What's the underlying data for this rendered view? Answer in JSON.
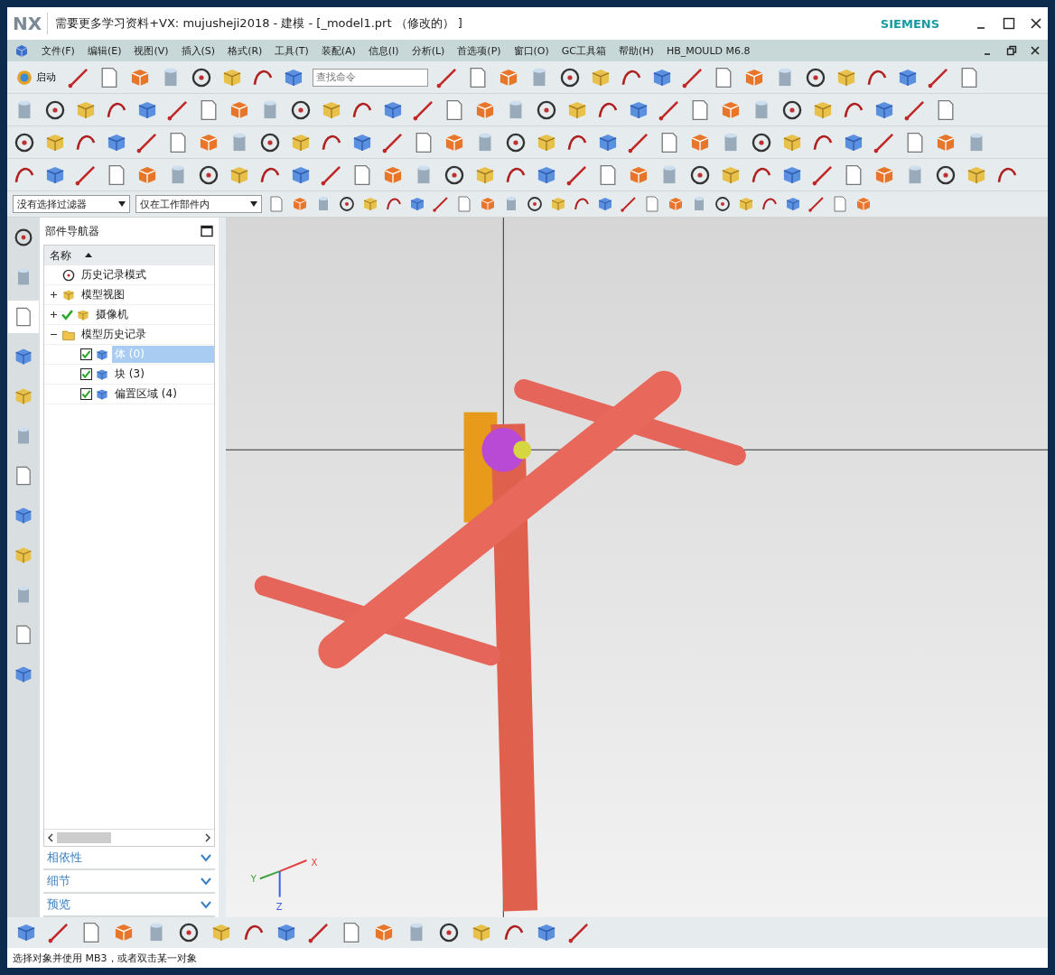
{
  "window": {
    "logo": "NX",
    "title": "需要更多学习资料+VX: mujusheji2018 - 建模 - [_model1.prt （修改的） ]",
    "brand": "SIEMENS"
  },
  "menu": [
    "文件(F)",
    "编辑(E)",
    "视图(V)",
    "插入(S)",
    "格式(R)",
    "工具(T)",
    "装配(A)",
    "信息(I)",
    "分析(L)",
    "首选项(P)",
    "窗口(O)",
    "GC工具箱",
    "帮助(H)",
    "HB_MOULD M6.8"
  ],
  "toolbar": {
    "start_label": "启动",
    "search": {
      "placeholder": "查找命令"
    }
  },
  "selection_bar": {
    "filter": "没有选择过滤器",
    "scope": "仅在工作部件内"
  },
  "side_tabs": [
    {
      "selected": false
    },
    {
      "selected": false
    },
    {
      "selected": true
    },
    {
      "selected": false
    },
    {
      "selected": false
    },
    {
      "selected": false
    },
    {
      "selected": false
    },
    {
      "selected": false
    },
    {
      "selected": false
    },
    {
      "selected": false
    },
    {
      "selected": false
    },
    {
      "selected": false
    }
  ],
  "navigator": {
    "title": "部件导航器",
    "column": "名称",
    "tree": [
      {
        "label": "历史记录模式",
        "selected": false
      },
      {
        "label": "模型视图",
        "selected": false,
        "expanded": false
      },
      {
        "label": "摄像机",
        "selected": false,
        "expanded": false,
        "checked": true
      },
      {
        "label": "模型历史记录",
        "selected": false,
        "expanded": true,
        "children": [
          {
            "label": "体 (0)",
            "selected": true,
            "checked": true
          },
          {
            "label": "块 (3)",
            "selected": false,
            "checked": true
          },
          {
            "label": "偏置区域 (4)",
            "selected": false,
            "checked": true
          }
        ]
      }
    ],
    "panels": [
      {
        "label": "相依性",
        "expanded": false
      },
      {
        "label": "细节",
        "expanded": false
      },
      {
        "label": "预览",
        "expanded": false
      }
    ]
  },
  "view_triad": {
    "x": "X",
    "y": "Y",
    "z": "Z"
  },
  "status_bar": "选择对象并使用 MB3，或者双击某一对象"
}
